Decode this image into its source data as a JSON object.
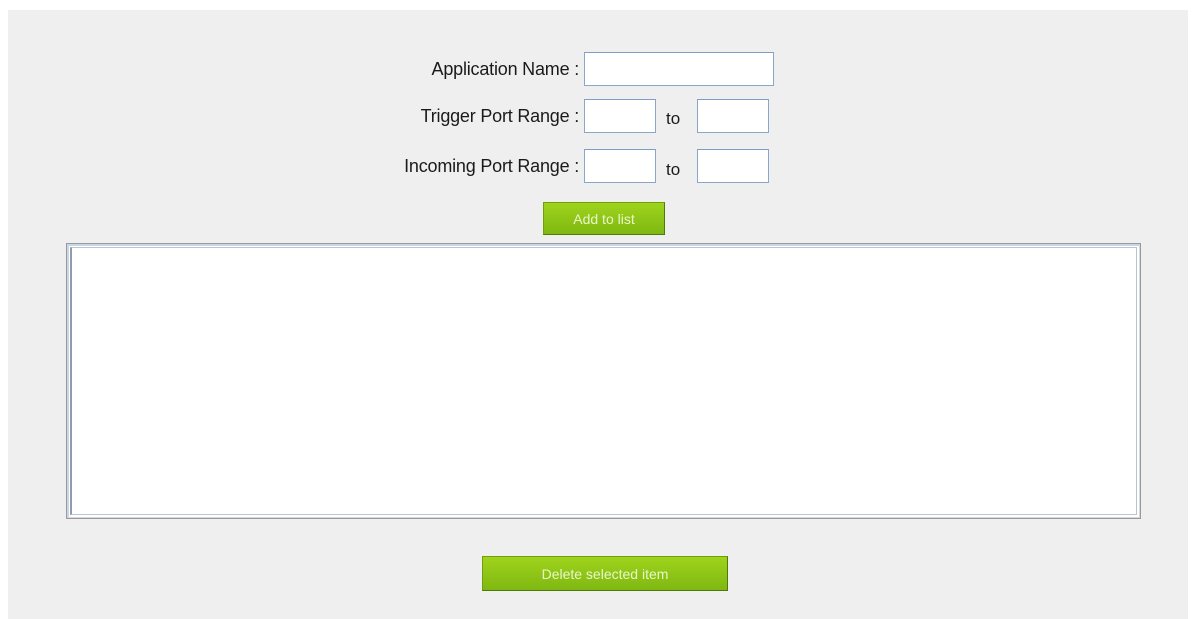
{
  "form": {
    "application_name_label": "Application Name :",
    "application_name_value": "",
    "trigger_port_range_label": "Trigger Port Range :",
    "trigger_port_start_value": "",
    "trigger_port_end_value": "",
    "incoming_port_range_label": "Incoming Port Range :",
    "incoming_port_start_value": "",
    "incoming_port_end_value": "",
    "to_label": "to",
    "add_button_label": "Add to list"
  },
  "list": {
    "items": []
  },
  "actions": {
    "delete_button_label": "Delete selected item"
  },
  "colors": {
    "panel_background": "#efefef",
    "button_green": "#8cc416",
    "input_border": "#8aa6c9"
  }
}
